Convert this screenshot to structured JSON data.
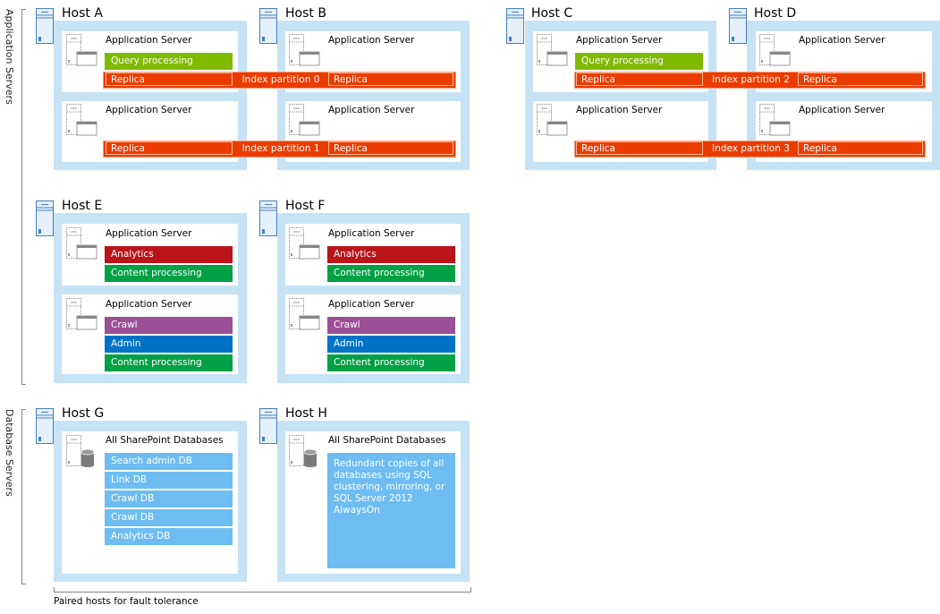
{
  "sections": {
    "app_servers_label": "Application Servers",
    "db_servers_label": "Database Servers",
    "footer": "Paired hosts for fault tolerance"
  },
  "colors": {
    "host_border": "#c6e3f4",
    "query_processing": "#7fba00",
    "index_partition": "#eb3c00",
    "analytics": "#ba141a",
    "content_processing": "#00a044",
    "crawl": "#9b4f96",
    "admin": "#0072c6",
    "database": "#6dbdf2"
  },
  "hosts": {
    "a": {
      "title": "Host A",
      "servers": [
        {
          "title": "Application Server",
          "components": [
            "Query processing"
          ],
          "replica": "Replica"
        },
        {
          "title": "Application Server",
          "components": [],
          "replica": "Replica"
        }
      ]
    },
    "b": {
      "title": "Host B",
      "servers": [
        {
          "title": "Application Server",
          "replica": "Replica"
        },
        {
          "title": "Application Server",
          "replica": "Replica"
        }
      ]
    },
    "c": {
      "title": "Host C",
      "servers": [
        {
          "title": "Application Server",
          "components": [
            "Query processing"
          ],
          "replica": "Replica"
        },
        {
          "title": "Application Server",
          "components": [],
          "replica": "Replica"
        }
      ]
    },
    "d": {
      "title": "Host D",
      "servers": [
        {
          "title": "Application Server",
          "replica": "Replica"
        },
        {
          "title": "Application Server",
          "replica": "Replica"
        }
      ]
    },
    "e": {
      "title": "Host E",
      "servers": [
        {
          "title": "Application Server",
          "components": [
            "Analytics",
            "Content processing"
          ]
        },
        {
          "title": "Application Server",
          "components": [
            "Crawl",
            "Admin",
            "Content processing"
          ]
        }
      ]
    },
    "f": {
      "title": "Host F",
      "servers": [
        {
          "title": "Application Server",
          "components": [
            "Analytics",
            "Content processing"
          ]
        },
        {
          "title": "Application Server",
          "components": [
            "Crawl",
            "Admin",
            "Content processing"
          ]
        }
      ]
    },
    "g": {
      "title": "Host G",
      "servers": [
        {
          "title": "All SharePoint Databases",
          "databases": [
            "Search admin DB",
            "Link DB",
            "Crawl DB",
            "Crawl DB",
            "Analytics DB"
          ]
        }
      ]
    },
    "h": {
      "title": "Host H",
      "servers": [
        {
          "title": "All SharePoint Databases",
          "note": "Redundant copies of all databases using SQL clustering, mirroring, or SQL Server 2012 AlwaysOn"
        }
      ]
    }
  },
  "index_partitions": [
    "Index partition 0",
    "Index partition 1",
    "Index partition 2",
    "Index partition 3"
  ]
}
